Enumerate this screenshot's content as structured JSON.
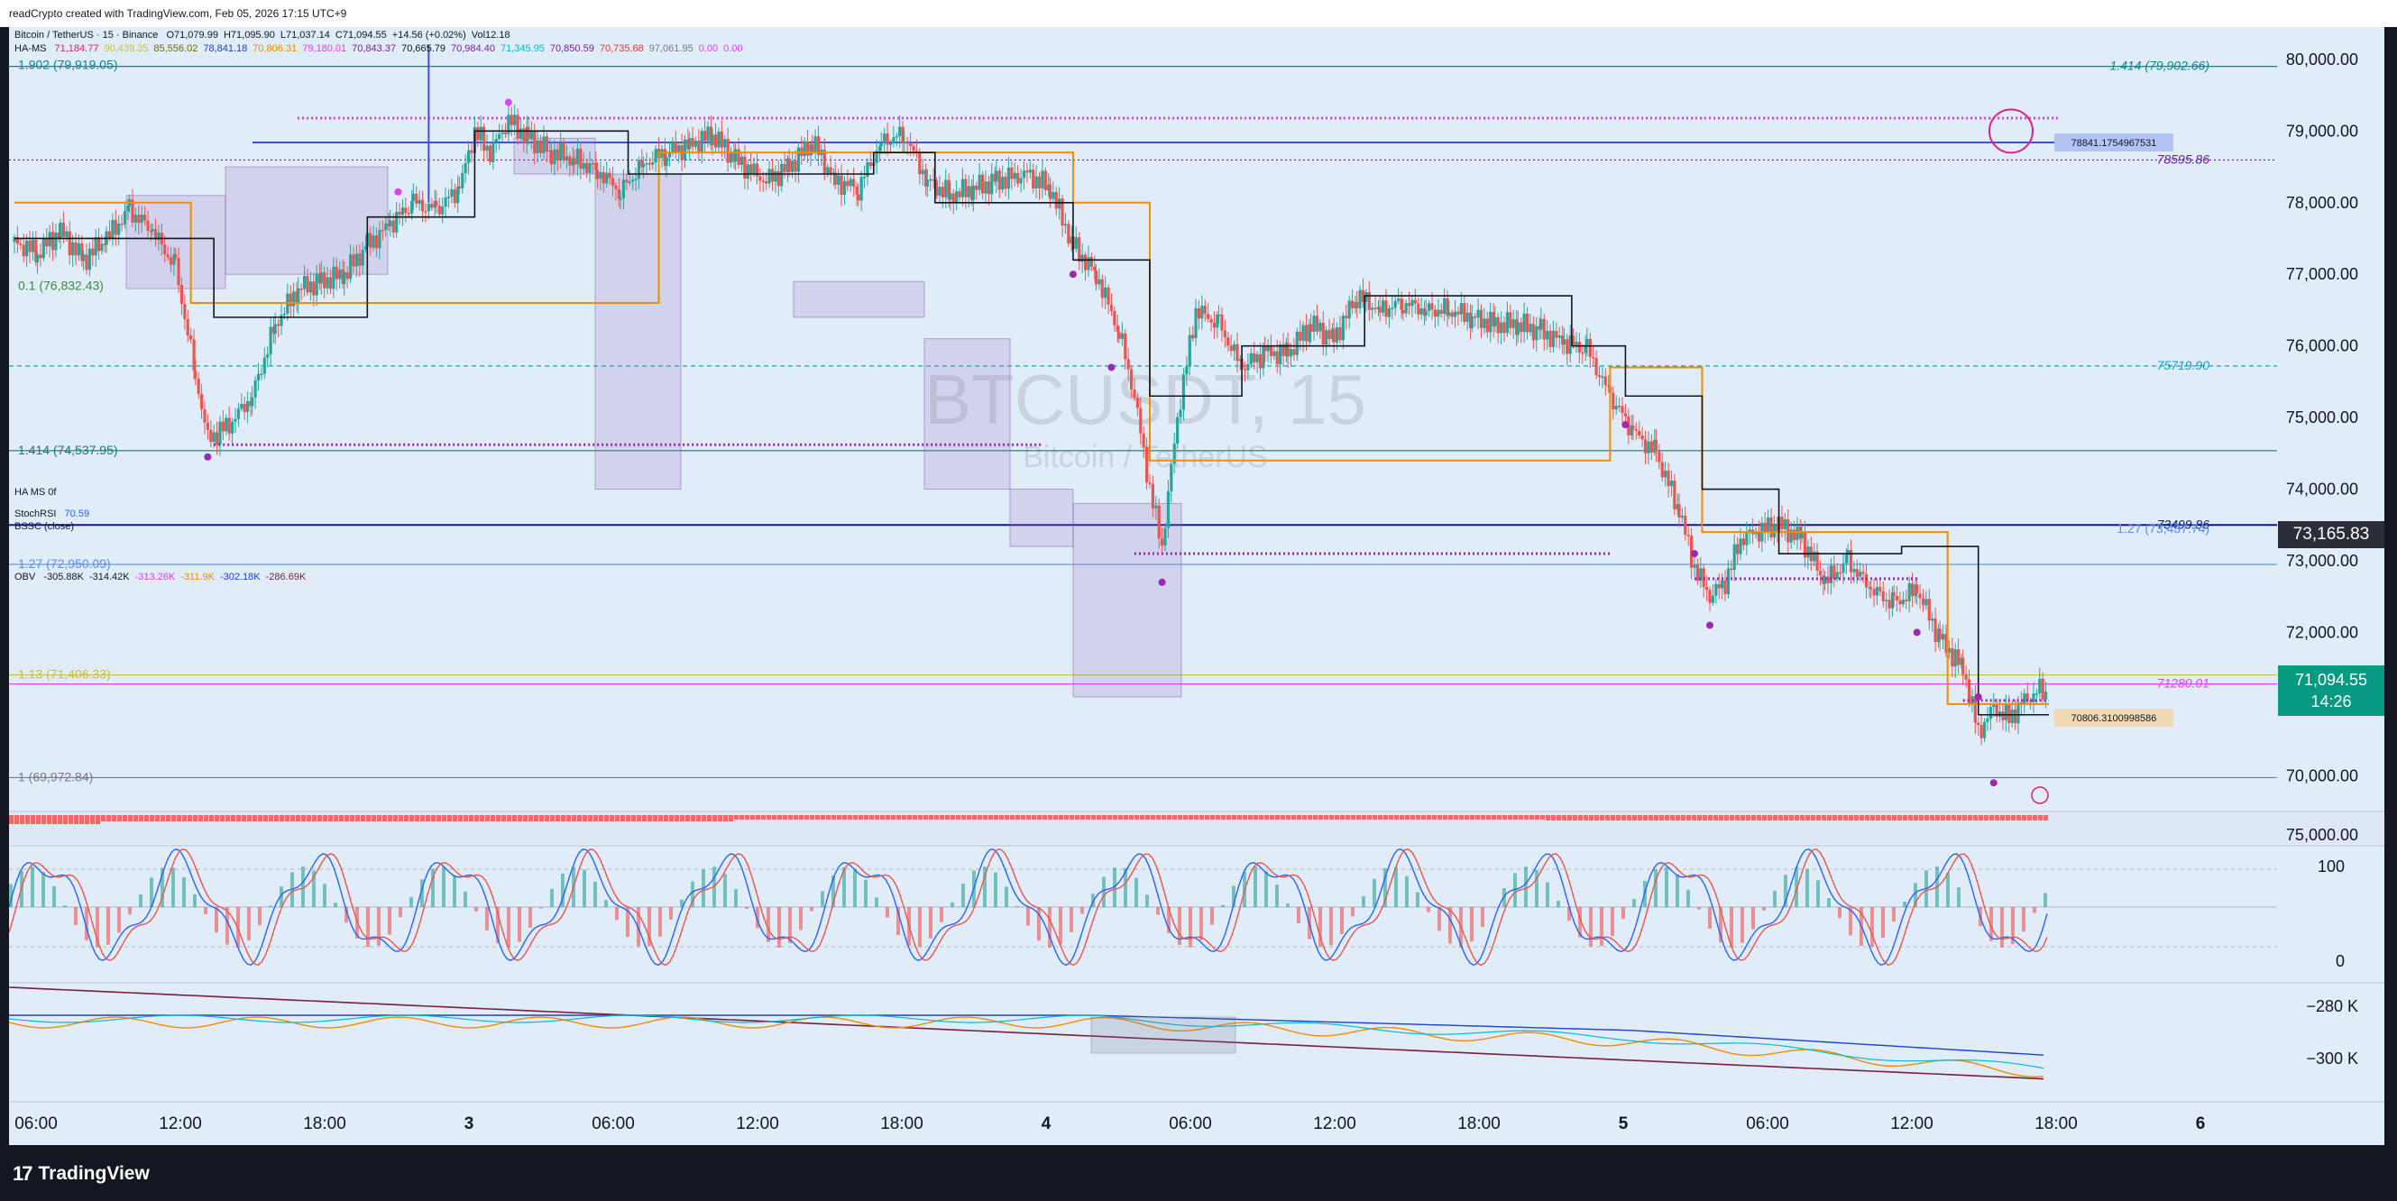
{
  "header": {
    "caption": "readCrypto created with TradingView.com, Feb 05, 2026 17:15 UTC+9"
  },
  "brand": {
    "name": "TradingView"
  },
  "legend": {
    "symbol": "Bitcoin / TetherUS · 15 · Binance",
    "ohlc": [
      "O71,079.99",
      "H71,095.90",
      "L71,037.14",
      "C71,094.55",
      "+14.56 (+0.02%)",
      "Vol12.18"
    ],
    "ha_ms_label": "HA-MS",
    "ha_ms_values": [
      {
        "t": "71,184.77",
        "c": "#e91e63"
      },
      {
        "t": "90,439.35",
        "c": "#c6c03f"
      },
      {
        "t": "85,556.02",
        "c": "#6d6d00"
      },
      {
        "t": "78,841.18",
        "c": "#1f3fd1"
      },
      {
        "t": "70,806.31",
        "c": "#f28c00"
      },
      {
        "t": "79,180.01",
        "c": "#e040fb"
      },
      {
        "t": "70,843.37",
        "c": "#7a1fa2"
      },
      {
        "t": "70,665.79",
        "c": "#131722"
      },
      {
        "t": "70,984.40",
        "c": "#7a1fa2"
      },
      {
        "t": "71,345.95",
        "c": "#00bcd4"
      },
      {
        "t": "70,850.59",
        "c": "#7a1fa2"
      },
      {
        "t": "70,735.68",
        "c": "#e53935"
      },
      {
        "t": "97,061.95",
        "c": "#787b86"
      },
      {
        "t": "0.00",
        "c": "#e040fb"
      },
      {
        "t": "0.00",
        "c": "#e040fb"
      }
    ],
    "stoch_label": "StochRSI",
    "stoch_value": "70.59",
    "bssc_label": "BSSC (close)",
    "obv_label": "OBV",
    "obv_values": [
      {
        "t": "-305.88K",
        "c": "#131722"
      },
      {
        "t": "-314.42K",
        "c": "#131722"
      },
      {
        "t": "-313.26K",
        "c": "#e040fb"
      },
      {
        "t": "-311.9K",
        "c": "#f28c00"
      },
      {
        "t": "-302.18K",
        "c": "#1f3fd1"
      },
      {
        "t": "-286.69K",
        "c": "#7a1f3d"
      }
    ],
    "hawk_label": "HA MS 0f"
  },
  "watermark": {
    "line1": "BTCUSDT, 15",
    "line2": "Bitcoin / TetherUS"
  },
  "chart_data": {
    "type": "candlestick",
    "symbol": "BTCUSDT",
    "interval": "15",
    "price_axis": {
      "min": 69500,
      "max": 80200,
      "ticks": [
        "80,000.00",
        "79,000.00",
        "78,000.00",
        "77,000.00",
        "76,000.00",
        "75,000.00",
        "74,000.00",
        "73,000.00",
        "72,000.00",
        "71,000.00",
        "70,000.00"
      ],
      "tick_values": [
        80000,
        79000,
        78000,
        77000,
        76000,
        75000,
        74000,
        73000,
        72000,
        71000,
        70000
      ]
    },
    "time_axis": {
      "ticks": [
        "06:00",
        "12:00",
        "18:00",
        "3",
        "06:00",
        "12:00",
        "18:00",
        "4",
        "06:00",
        "12:00",
        "18:00",
        "5",
        "06:00",
        "12:00",
        "18:00",
        "6"
      ],
      "bold": [
        3,
        7,
        11,
        15
      ]
    },
    "close_path": [
      [
        0,
        77450
      ],
      [
        15,
        77300
      ],
      [
        30,
        77600
      ],
      [
        45,
        77200
      ],
      [
        60,
        77500
      ],
      [
        75,
        77900
      ],
      [
        90,
        77600
      ],
      [
        105,
        77100
      ],
      [
        118,
        75600
      ],
      [
        126,
        74700
      ],
      [
        140,
        74900
      ],
      [
        155,
        75300
      ],
      [
        170,
        76300
      ],
      [
        185,
        76800
      ],
      [
        200,
        76900
      ],
      [
        215,
        77000
      ],
      [
        230,
        77400
      ],
      [
        245,
        77700
      ],
      [
        260,
        78000
      ],
      [
        275,
        77900
      ],
      [
        290,
        78200
      ],
      [
        300,
        79000
      ],
      [
        310,
        78700
      ],
      [
        322,
        79150
      ],
      [
        335,
        78900
      ],
      [
        350,
        78700
      ],
      [
        365,
        78600
      ],
      [
        380,
        78450
      ],
      [
        395,
        78150
      ],
      [
        410,
        78550
      ],
      [
        425,
        78700
      ],
      [
        440,
        78800
      ],
      [
        455,
        78950
      ],
      [
        470,
        78600
      ],
      [
        490,
        78300
      ],
      [
        505,
        78500
      ],
      [
        520,
        78850
      ],
      [
        535,
        78300
      ],
      [
        550,
        78200
      ],
      [
        565,
        78850
      ],
      [
        580,
        78950
      ],
      [
        595,
        78300
      ],
      [
        610,
        78100
      ],
      [
        625,
        78200
      ],
      [
        640,
        78300
      ],
      [
        660,
        78400
      ],
      [
        675,
        78200
      ],
      [
        690,
        77400
      ],
      [
        705,
        77000
      ],
      [
        720,
        76200
      ],
      [
        730,
        75300
      ],
      [
        740,
        74000
      ],
      [
        748,
        73200
      ],
      [
        758,
        75000
      ],
      [
        770,
        76500
      ],
      [
        785,
        76300
      ],
      [
        800,
        75700
      ],
      [
        815,
        75900
      ],
      [
        830,
        75900
      ],
      [
        845,
        76300
      ],
      [
        860,
        76100
      ],
      [
        875,
        76700
      ],
      [
        890,
        76500
      ],
      [
        905,
        76600
      ],
      [
        920,
        76500
      ],
      [
        935,
        76500
      ],
      [
        950,
        76400
      ],
      [
        965,
        76300
      ],
      [
        980,
        76300
      ],
      [
        995,
        76200
      ],
      [
        1010,
        76050
      ],
      [
        1025,
        75950
      ],
      [
        1040,
        75300
      ],
      [
        1055,
        74800
      ],
      [
        1070,
        74500
      ],
      [
        1085,
        73700
      ],
      [
        1095,
        72900
      ],
      [
        1105,
        72500
      ],
      [
        1115,
        72700
      ],
      [
        1125,
        73300
      ],
      [
        1135,
        73400
      ],
      [
        1150,
        73500
      ],
      [
        1165,
        73300
      ],
      [
        1180,
        72700
      ],
      [
        1195,
        73000
      ],
      [
        1210,
        72600
      ],
      [
        1225,
        72400
      ],
      [
        1240,
        72600
      ],
      [
        1255,
        71900
      ],
      [
        1270,
        71500
      ],
      [
        1280,
        70600
      ],
      [
        1290,
        70950
      ],
      [
        1300,
        70800
      ],
      [
        1310,
        71050
      ],
      [
        1320,
        71200
      ],
      [
        1326,
        71090
      ]
    ],
    "levels": [
      {
        "label": "1.414 (79,902.66)",
        "price": 79902.66,
        "color": "#008b8b",
        "side": "right"
      },
      {
        "label": "78595.86",
        "price": 78595.86,
        "color": "#6a1b9a",
        "side": "right",
        "dotted": true
      },
      {
        "label": "75719.90",
        "price": 75719.9,
        "color": "#00acc1",
        "side": "right",
        "dashed": true
      },
      {
        "label": "1.414 (74,537.95)",
        "price": 74537.95,
        "color": "#1b7a6b",
        "side": "left"
      },
      {
        "label": "73499.86",
        "price": 73499.86,
        "color": "#0d1a8a",
        "side": "right"
      },
      {
        "label": "1.27 (72,950.09)",
        "price": 72950.09,
        "color": "#5b8def",
        "side": "left"
      },
      {
        "label": "1.13 (71,406.33)",
        "price": 71406.33,
        "color": "#c6c03f",
        "side": "left"
      },
      {
        "label": "71280.01",
        "price": 71280.01,
        "color": "#e040fb",
        "side": "right"
      },
      {
        "label": "1 (69,972.84)",
        "price": 69972.84,
        "color": "#787b86",
        "side": "left"
      }
    ],
    "partial_labels": {
      "top_left": "1.902 (79,919.05)",
      "left_mid": "0.1 (76,832.43)",
      "right_127": "1.27 (73,437.74)"
    },
    "callouts": [
      {
        "label": "78841.1754967531",
        "price": 78841.18,
        "color": "#b3c3f5"
      },
      {
        "label": "70806.3100998586",
        "price": 70806.31,
        "color": "#f0d9b5"
      }
    ],
    "current_price": {
      "value": "71,094.55",
      "countdown": "14:26",
      "color": "#089981"
    },
    "crosshair_price": {
      "value": "73,165.83"
    },
    "hawk_axis": {
      "label": "75,000.00"
    },
    "stoch_axis": {
      "ticks": [
        "100",
        "0"
      ]
    },
    "obv_axis": {
      "ticks": [
        "−280 K",
        "−300 K"
      ]
    },
    "colors": {
      "up": "#26a69a",
      "down": "#ef5350",
      "bg": "#e0ecf8",
      "axis_text": "#131722"
    }
  }
}
